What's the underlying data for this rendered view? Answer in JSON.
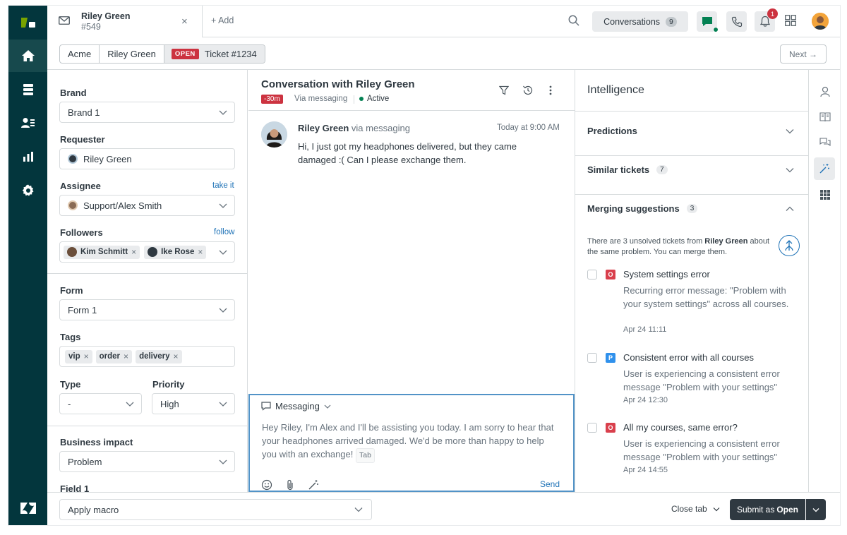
{
  "colors": {
    "nav_bg": "#03363d",
    "accent": "#1f73b7",
    "danger": "#cc3340",
    "active_green": "#038153"
  },
  "topbar": {
    "tab": {
      "title": "Riley Green",
      "subtitle": "#549",
      "close": "×"
    },
    "add_label": "+ Add",
    "conversations": {
      "label": "Conversations",
      "count": "9"
    },
    "notifications_count": "1"
  },
  "breadcrumb": {
    "org": "Acme",
    "requester": "Riley Green",
    "status": "OPEN",
    "ticket": "Ticket #1234"
  },
  "next_label": "Next →",
  "left": {
    "brand": {
      "label": "Brand",
      "value": "Brand 1"
    },
    "requester": {
      "label": "Requester",
      "value": "Riley Green"
    },
    "assignee": {
      "label": "Assignee",
      "link": "take it",
      "value": "Support/Alex Smith"
    },
    "followers": {
      "label": "Followers",
      "link": "follow",
      "items": [
        "Kim Schmitt",
        "Ike Rose"
      ]
    },
    "form": {
      "label": "Form",
      "value": "Form 1"
    },
    "tags": {
      "label": "Tags",
      "items": [
        "vip",
        "order",
        "delivery"
      ]
    },
    "type": {
      "label": "Type",
      "value": "-"
    },
    "priority": {
      "label": "Priority",
      "value": "High"
    },
    "business_impact": {
      "label": "Business impact",
      "value": "Problem"
    },
    "field1": {
      "label": "Field 1"
    }
  },
  "conversation": {
    "title": "Conversation with Riley Green",
    "time_badge": "-30m",
    "via": "Via messaging",
    "status": "Active",
    "message": {
      "sender": "Riley Green",
      "via": "via messaging",
      "time": "Today at 9:00 AM",
      "text": "Hi, I just got my headphones delivered, but they came damaged :( Can I please exchange them."
    },
    "composer": {
      "channel": "Messaging",
      "draft": "Hey Riley, I'm Alex and I'll be assisting you today. I am sorry to hear that your headphones arrived damaged. We'd be more than happy to help you with an exchange!",
      "tab_hint": "Tab",
      "send": "Send"
    }
  },
  "intelligence": {
    "title": "Intelligence",
    "predictions": "Predictions",
    "similar": {
      "label": "Similar tickets",
      "count": "7"
    },
    "merging": {
      "label": "Merging suggestions",
      "count": "3",
      "desc_prefix": "There are 3 unsolved tickets from ",
      "desc_name": "Riley Green",
      "desc_suffix": " about the same problem. You can merge them."
    },
    "suggestions": [
      {
        "status": "O",
        "title": "System settings error",
        "desc": "Recurring error message: \"Problem with your system settings\" across all courses.",
        "date": "Apr 24 11:11"
      },
      {
        "status": "P",
        "title": "Consistent error with all courses",
        "desc": "User is experiencing a consistent error message \"Problem with your settings\"",
        "date": "Apr 24 12:30"
      },
      {
        "status": "O",
        "title": "All my courses, same error?",
        "desc": "User is experiencing a consistent error message \"Problem with your settings\"",
        "date": "Apr 24 14:55"
      }
    ]
  },
  "bottom": {
    "macro": "Apply macro",
    "close_tab": "Close tab",
    "submit_prefix": "Submit as",
    "submit_status": "Open"
  }
}
